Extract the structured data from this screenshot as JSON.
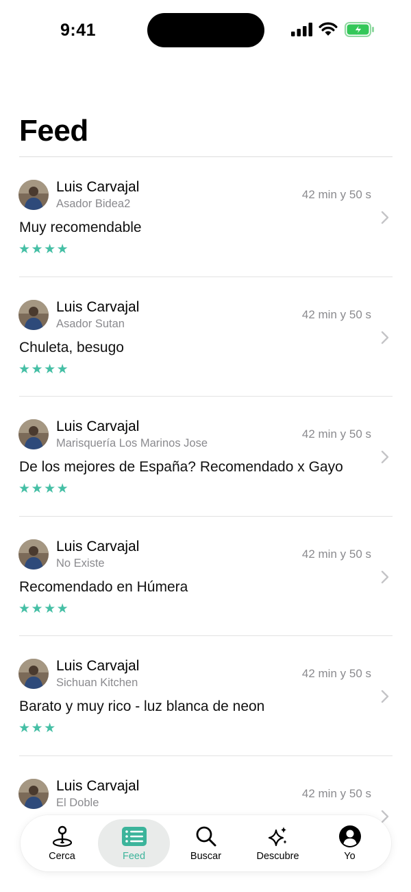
{
  "status_bar": {
    "time": "9:41"
  },
  "header": {
    "title": "Feed"
  },
  "feed": [
    {
      "name": "Luis Carvajal",
      "restaurant": "Asador Bidea2",
      "time": "42 min y 50 s",
      "comment": "Muy recomendable",
      "stars": "★★★★",
      "rating": 4
    },
    {
      "name": "Luis Carvajal",
      "restaurant": "Asador Sutan",
      "time": "42 min y 50 s",
      "comment": "Chuleta, besugo",
      "stars": "★★★★",
      "rating": 4
    },
    {
      "name": "Luis Carvajal",
      "restaurant": "Marisquería Los Marinos Jose",
      "time": "42 min y 50 s",
      "comment": "De los mejores de España? Recomendado x Gayo",
      "stars": "★★★★",
      "rating": 4
    },
    {
      "name": "Luis Carvajal",
      "restaurant": "No Existe",
      "time": "42 min y 50 s",
      "comment": "Recomendado en Húmera",
      "stars": "★★★★",
      "rating": 4
    },
    {
      "name": "Luis Carvajal",
      "restaurant": "Sichuan Kitchen",
      "time": "42 min y 50 s",
      "comment": "Barato y muy rico - luz blanca de neon",
      "stars": "★★★",
      "rating": 3
    },
    {
      "name": "Luis Carvajal",
      "restaurant": "El Doble",
      "time": "42 min y 50 s",
      "comment": "",
      "stars": "",
      "rating": null
    }
  ],
  "tab_bar": {
    "tabs": [
      {
        "label": "Cerca",
        "icon": "map-pin-icon",
        "active": false
      },
      {
        "label": "Feed",
        "icon": "list-icon",
        "active": true
      },
      {
        "label": "Buscar",
        "icon": "search-icon",
        "active": false
      },
      {
        "label": "Descubre",
        "icon": "sparkles-icon",
        "active": false
      },
      {
        "label": "Yo",
        "icon": "person-circle-icon",
        "active": false
      }
    ]
  },
  "colors": {
    "accent": "#45bfa5",
    "secondary_text": "#8a8a8e",
    "battery": "#34c759"
  }
}
